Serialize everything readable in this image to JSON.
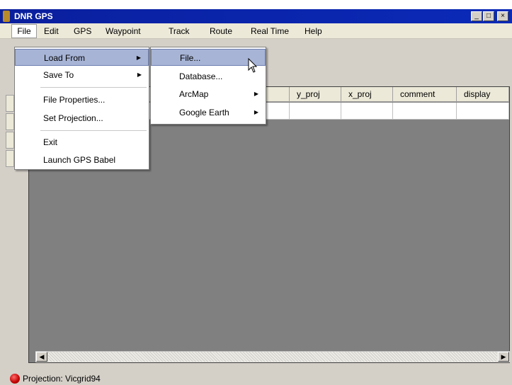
{
  "window": {
    "title": "DNR GPS",
    "min": "_",
    "max": "□",
    "close": "×"
  },
  "menubar": [
    "File",
    "Edit",
    "GPS",
    "Waypoint",
    "Track",
    "Route",
    "Real Time",
    "Help"
  ],
  "file_menu": {
    "load_from": "Load From",
    "save_to": "Save To",
    "file_properties": "File Properties...",
    "set_projection": "Set Projection...",
    "exit": "Exit",
    "launch_gps_babel": "Launch GPS Babel"
  },
  "load_submenu": {
    "file": "File...",
    "database": "Database...",
    "arcmap": "ArcMap",
    "google_earth": "Google Earth"
  },
  "grid": {
    "columns": [
      "y_proj",
      "x_proj",
      "comment",
      "display"
    ]
  },
  "status": {
    "text": "Projection: Vicgrid94"
  }
}
